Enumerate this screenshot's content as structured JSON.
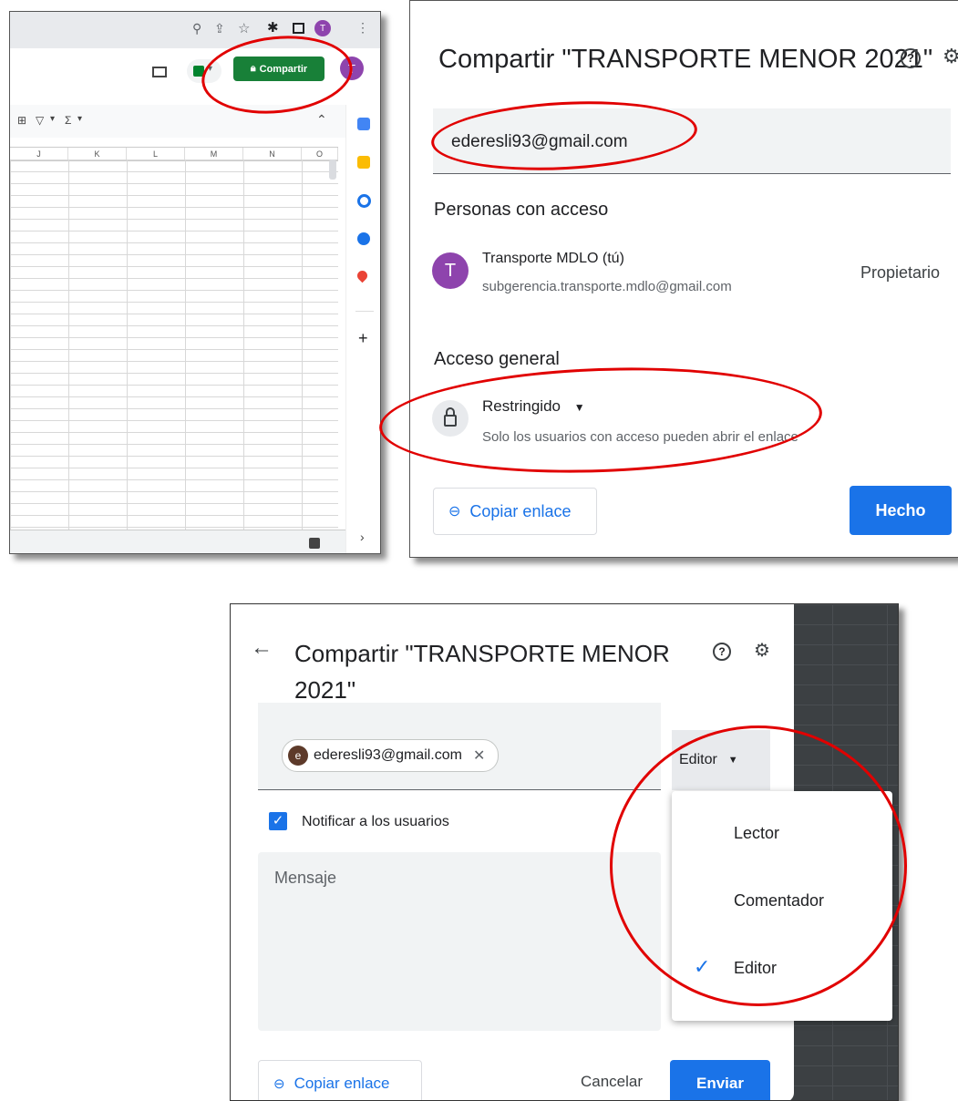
{
  "sheet": {
    "columns": [
      "J",
      "K",
      "L",
      "M",
      "N",
      "O"
    ],
    "share_button": "Compartir",
    "avatar_letter": "T",
    "toolbar_symbols": [
      "⊞",
      "▽",
      "▾",
      "Σ",
      "▾"
    ]
  },
  "share_dialog": {
    "title": "Compartir \"TRANSPORTE MENOR 2021\"",
    "email_value": "ederesli93@gmail.com",
    "people_heading": "Personas con acceso",
    "owner_name": "Transporte MDLO (tú)",
    "owner_email": "subgerencia.transporte.mdlo@gmail.com",
    "owner_role": "Propietario",
    "owner_avatar": "T",
    "general_heading": "Acceso general",
    "restriction_label": "Restringido",
    "restriction_desc": "Solo los usuarios con acceso pueden abrir el enlace",
    "copy_link": "Copiar enlace",
    "done": "Hecho"
  },
  "invite_dialog": {
    "title_line1": "Compartir \"TRANSPORTE MENOR",
    "title_line2": "2021\"",
    "chip_email": "ederesli93@gmail.com",
    "chip_avatar": "e",
    "role_selected": "Editor",
    "notify_label": "Notificar a los usuarios",
    "message_placeholder": "Mensaje",
    "copy_link": "Copiar enlace",
    "cancel": "Cancelar",
    "send": "Enviar",
    "role_options": [
      "Lector",
      "Comentador",
      "Editor"
    ]
  },
  "colors": {
    "share_green": "#188038",
    "primary_blue": "#1a73e8",
    "annotation_red": "#e10000",
    "avatar_purple": "#8e44ad"
  }
}
